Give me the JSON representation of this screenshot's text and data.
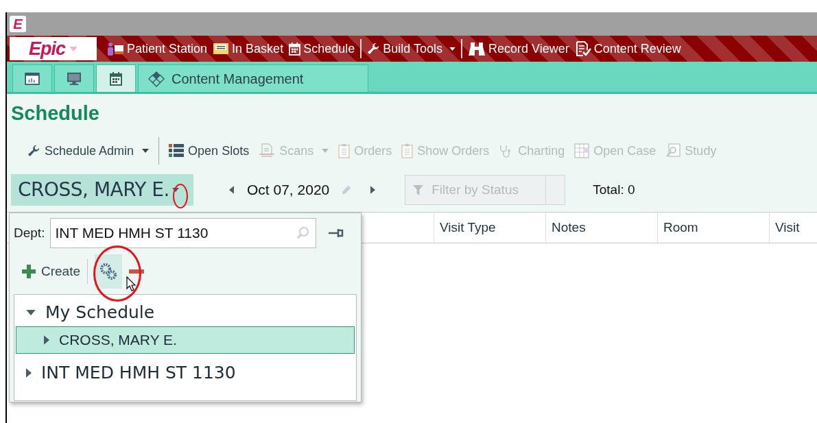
{
  "app_logo": "E",
  "menu_bar": {
    "logo": "Epic",
    "items": [
      {
        "label": "Patient Station",
        "kind": "patient",
        "dropdown": false
      },
      {
        "label": "In Basket",
        "kind": "inbox",
        "dropdown": false
      },
      {
        "label": "Schedule",
        "kind": "calendar",
        "dropdown": false
      },
      {
        "label": "Build Tools",
        "kind": "wrench",
        "dropdown": true
      },
      {
        "label": "Record Viewer",
        "kind": "binoculars",
        "dropdown": false
      },
      {
        "label": "Content Review",
        "kind": "review",
        "dropdown": false
      }
    ]
  },
  "tabs": [
    {
      "kind": "dashboard",
      "selected": false
    },
    {
      "kind": "monitor",
      "selected": false
    },
    {
      "kind": "calendar",
      "selected": true
    },
    {
      "kind": "diamond",
      "label": "Content Management",
      "selected": false
    }
  ],
  "page_title": "Schedule",
  "toolbar": [
    {
      "label": "Schedule Admin",
      "kind": "wrench",
      "disabled": false,
      "dropdown": true
    },
    {
      "label": "Open Slots",
      "kind": "grid",
      "disabled": false,
      "dropdown": false
    },
    {
      "label": "Scans",
      "kind": "scan",
      "disabled": true,
      "dropdown": true
    },
    {
      "label": "Orders",
      "kind": "clipboard",
      "disabled": true,
      "dropdown": false
    },
    {
      "label": "Show Orders",
      "kind": "clipboard",
      "disabled": true,
      "dropdown": false
    },
    {
      "label": "Charting",
      "kind": "stethoscope",
      "disabled": true,
      "dropdown": false
    },
    {
      "label": "Open Case",
      "kind": "table",
      "disabled": true,
      "dropdown": false
    },
    {
      "label": "Study",
      "kind": "search",
      "disabled": true,
      "dropdown": false
    }
  ],
  "provider": {
    "name": "CROSS, MARY E."
  },
  "date": "Oct 07, 2020",
  "filter": {
    "placeholder": "Filter by Status"
  },
  "total": "Total: 0",
  "columns": [
    "Visit Type",
    "Notes",
    "Room",
    "Visit"
  ],
  "popup": {
    "dept_label": "Dept:",
    "dept_value": "INT MED HMH ST 1130",
    "create": "Create",
    "tree": [
      {
        "label": "My Schedule",
        "expanded": true,
        "selected": false,
        "children": [
          {
            "label": "CROSS, MARY E.",
            "expanded": false,
            "selected": true
          }
        ]
      },
      {
        "label": "INT MED HMH ST 1130",
        "expanded": false,
        "selected": false
      }
    ]
  }
}
